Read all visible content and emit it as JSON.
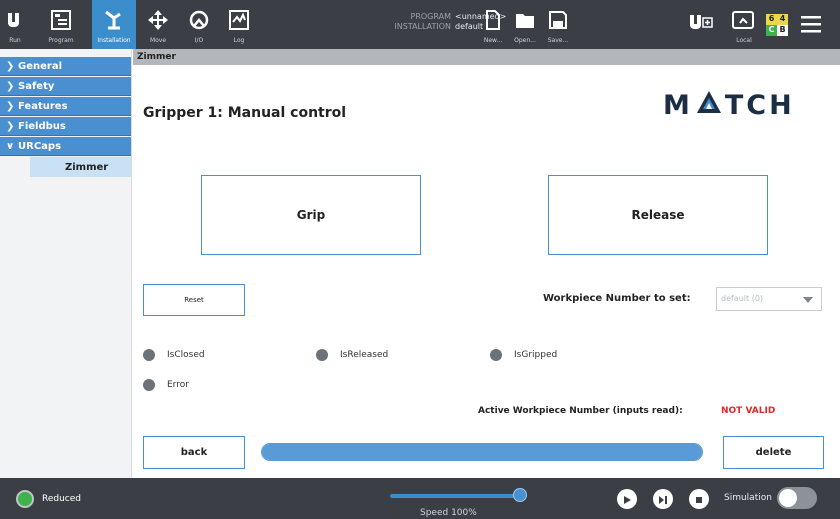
{
  "topbar": {
    "buttons": [
      {
        "label": "Run",
        "icon": "ur-logo-icon"
      },
      {
        "label": "Program",
        "icon": "program-icon"
      },
      {
        "label": "Installation",
        "icon": "installation-icon",
        "active": true
      },
      {
        "label": "Move",
        "icon": "move-arrows-icon"
      },
      {
        "label": "I/O",
        "icon": "io-icon"
      },
      {
        "label": "Log",
        "icon": "log-icon"
      }
    ],
    "program_key": "PROGRAM",
    "program_value": "<unnamed>",
    "installation_key": "INSTALLATION",
    "installation_value": "default",
    "file_buttons": [
      {
        "label": "New...",
        "icon": "new-file-icon"
      },
      {
        "label": "Open...",
        "icon": "open-folder-icon"
      },
      {
        "label": "Save...",
        "icon": "save-icon"
      }
    ],
    "local_label": "Local",
    "robot_counts": [
      "6",
      "4",
      "C",
      "B"
    ]
  },
  "sidebar": {
    "items": [
      {
        "label": "General",
        "expanded": false
      },
      {
        "label": "Safety",
        "expanded": false
      },
      {
        "label": "Features",
        "expanded": false
      },
      {
        "label": "Fieldbus",
        "expanded": false
      },
      {
        "label": "URCaps",
        "expanded": true
      }
    ],
    "subitem": "Zimmer"
  },
  "content": {
    "breadcrumb": "Zimmer",
    "title": "Gripper 1: Manual control",
    "logo_text_left": "M",
    "logo_text_right": "TCH",
    "grip_label": "Grip",
    "release_label": "Release",
    "reset_label": "Reset",
    "workpiece_label": "Workpiece Number to set:",
    "workpiece_value": "default (0)",
    "indicators": {
      "closed": "IsClosed",
      "released": "IsReleased",
      "gripped": "IsGripped",
      "error": "Error"
    },
    "active_label": "Active Workpiece Number (inputs read):",
    "active_value": "NOT VALID",
    "back_label": "back",
    "delete_label": "delete",
    "progress": 1.0
  },
  "bottombar": {
    "mode": "Reduced",
    "speed_label": "Speed 100%",
    "speed": 1.0,
    "simulation_label": "Simulation"
  },
  "colors": {
    "accent": "#4a90d0",
    "topbar": "#3b3f45",
    "error_text": "#e32626",
    "led_on": "#3fb34b"
  }
}
